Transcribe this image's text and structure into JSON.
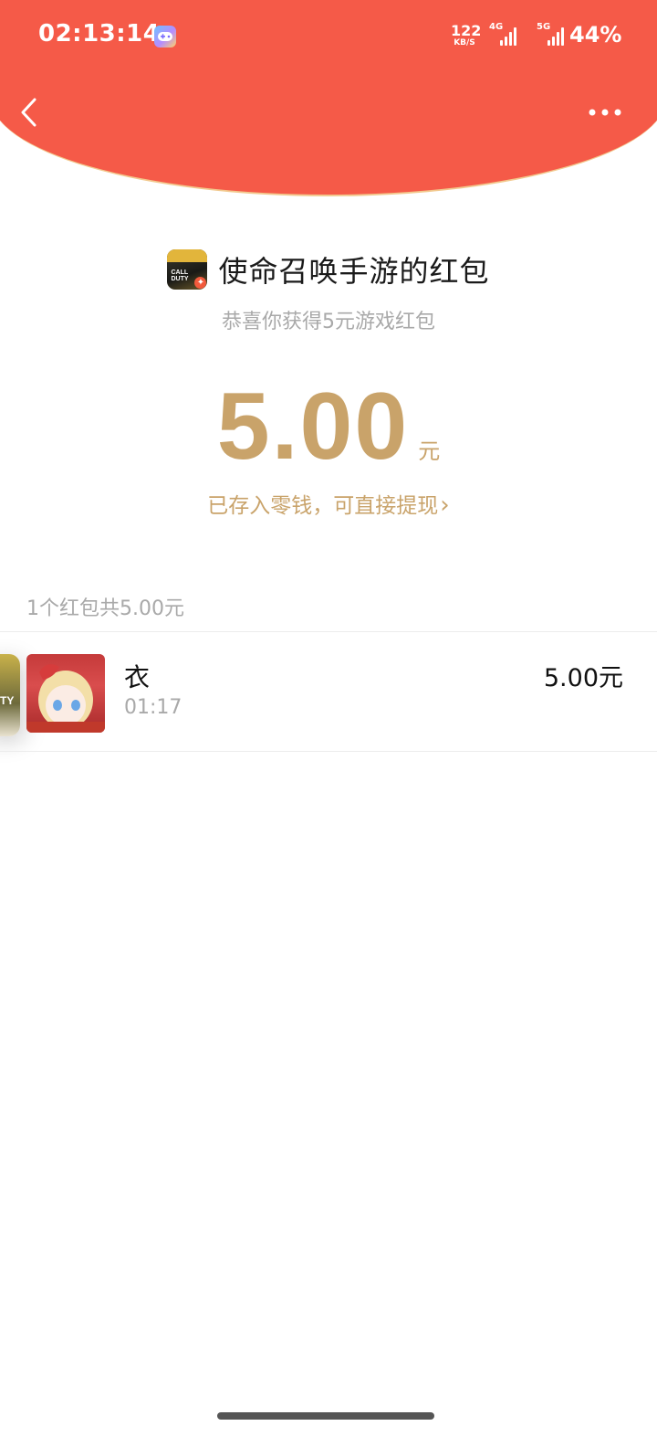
{
  "status_bar": {
    "time": "02:13:14",
    "net_speed": "122",
    "net_speed_unit": "KB/S",
    "sim1_label": "4G",
    "sim2_label": "5G",
    "battery": "44%"
  },
  "nav": {
    "back_icon": "chevron-left-icon",
    "more_icon": "more-dots-icon"
  },
  "red_packet": {
    "title": "使命召唤手游的红包",
    "subtitle": "恭喜你获得5元游戏红包",
    "amount": "5.00",
    "amount_unit": "元",
    "stored_link": "已存入零钱，可直接提现"
  },
  "records": {
    "summary": "1个红包共5.00元",
    "items": [
      {
        "name": "衣",
        "time": "01:17",
        "amount": "5.00元"
      }
    ]
  },
  "colors": {
    "header_red": "#f55a48",
    "gold": "#c9a36a",
    "muted_text": "#a9a9a9"
  }
}
